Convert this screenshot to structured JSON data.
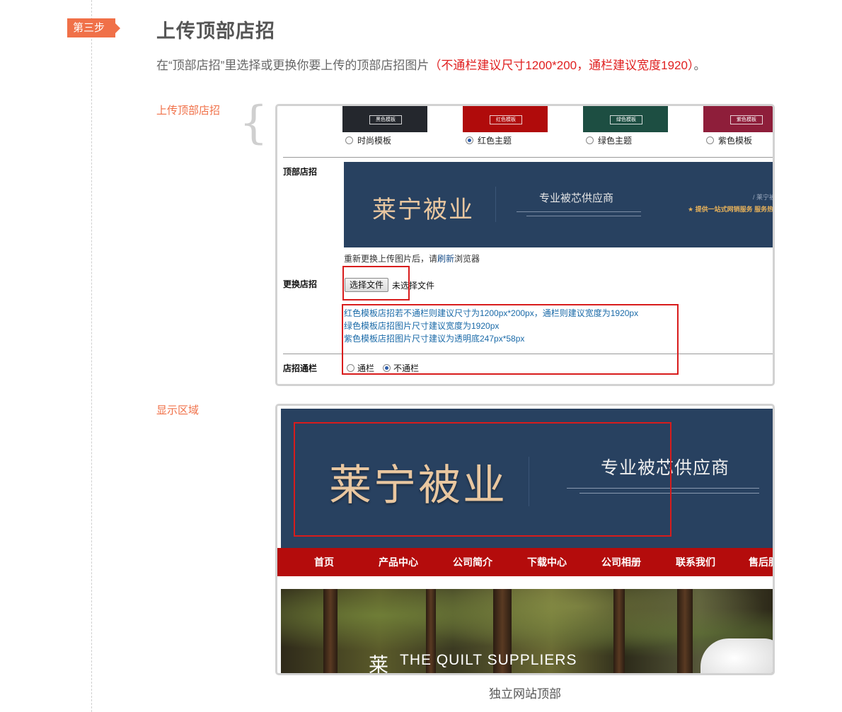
{
  "step_badge": "第三步",
  "title": "上传顶部店招",
  "description": {
    "prefix": "在“顶部店招”里选择或更换你要上传的顶部店招图片",
    "highlight": "（不通栏建议尺寸1200*200，通栏建议宽度1920）",
    "suffix": "。"
  },
  "labels": {
    "upload": "上传顶部店招",
    "display": "显示区域"
  },
  "colors": {
    "accent": "#f07048",
    "highlight_red": "#e02020",
    "banner_navy": "#284160",
    "nav_red": "#b40c0c",
    "hint_blue": "#1a6aa8"
  },
  "templates": [
    {
      "thumb_label": "黑色模板",
      "option": "时尚模板",
      "color": "#24272d",
      "checked": false
    },
    {
      "thumb_label": "红色模板",
      "option": "红色主题",
      "color": "#b00b0b",
      "checked": true
    },
    {
      "thumb_label": "绿色模板",
      "option": "绿色主题",
      "color": "#1d4e42",
      "checked": false
    },
    {
      "thumb_label": "紫色模板",
      "option": "紫色模板",
      "color": "#8e1e3a",
      "checked": false
    }
  ],
  "form": {
    "top_sign_label": "顶部店招",
    "refresh_note": {
      "prefix": "重新更换上传图片后，请",
      "link": "刷新",
      "suffix": "浏览器"
    },
    "change_label": "更换店招",
    "file_button": "选择文件",
    "no_file": "未选择文件",
    "hints": [
      "红色模板店招若不通栏则建议尺寸为1200px*200px，通栏则建议宽度为1920px",
      "绿色模板店招图片尺寸建议宽度为1920px",
      "紫色模板店招图片尺寸建议为透明底247px*58px"
    ],
    "full_width_label": "店招通栏",
    "full_width_options": [
      {
        "label": "通栏",
        "checked": false
      },
      {
        "label": "不通栏",
        "checked": true
      }
    ]
  },
  "banner": {
    "brand": "莱宁被业",
    "slogan": "专业被芯供应商",
    "crumb": "/ 莱宁被",
    "service": "★ 提供一站式网销服务  服务热"
  },
  "nav_items": [
    "首页",
    "产品中心",
    "公司简介",
    "下载中心",
    "公司相册",
    "联系我们",
    "售后服"
  ],
  "hero": {
    "glyph": "莱",
    "text": "THE QUILT SUPPLIERS"
  },
  "caption": "独立网站顶部"
}
